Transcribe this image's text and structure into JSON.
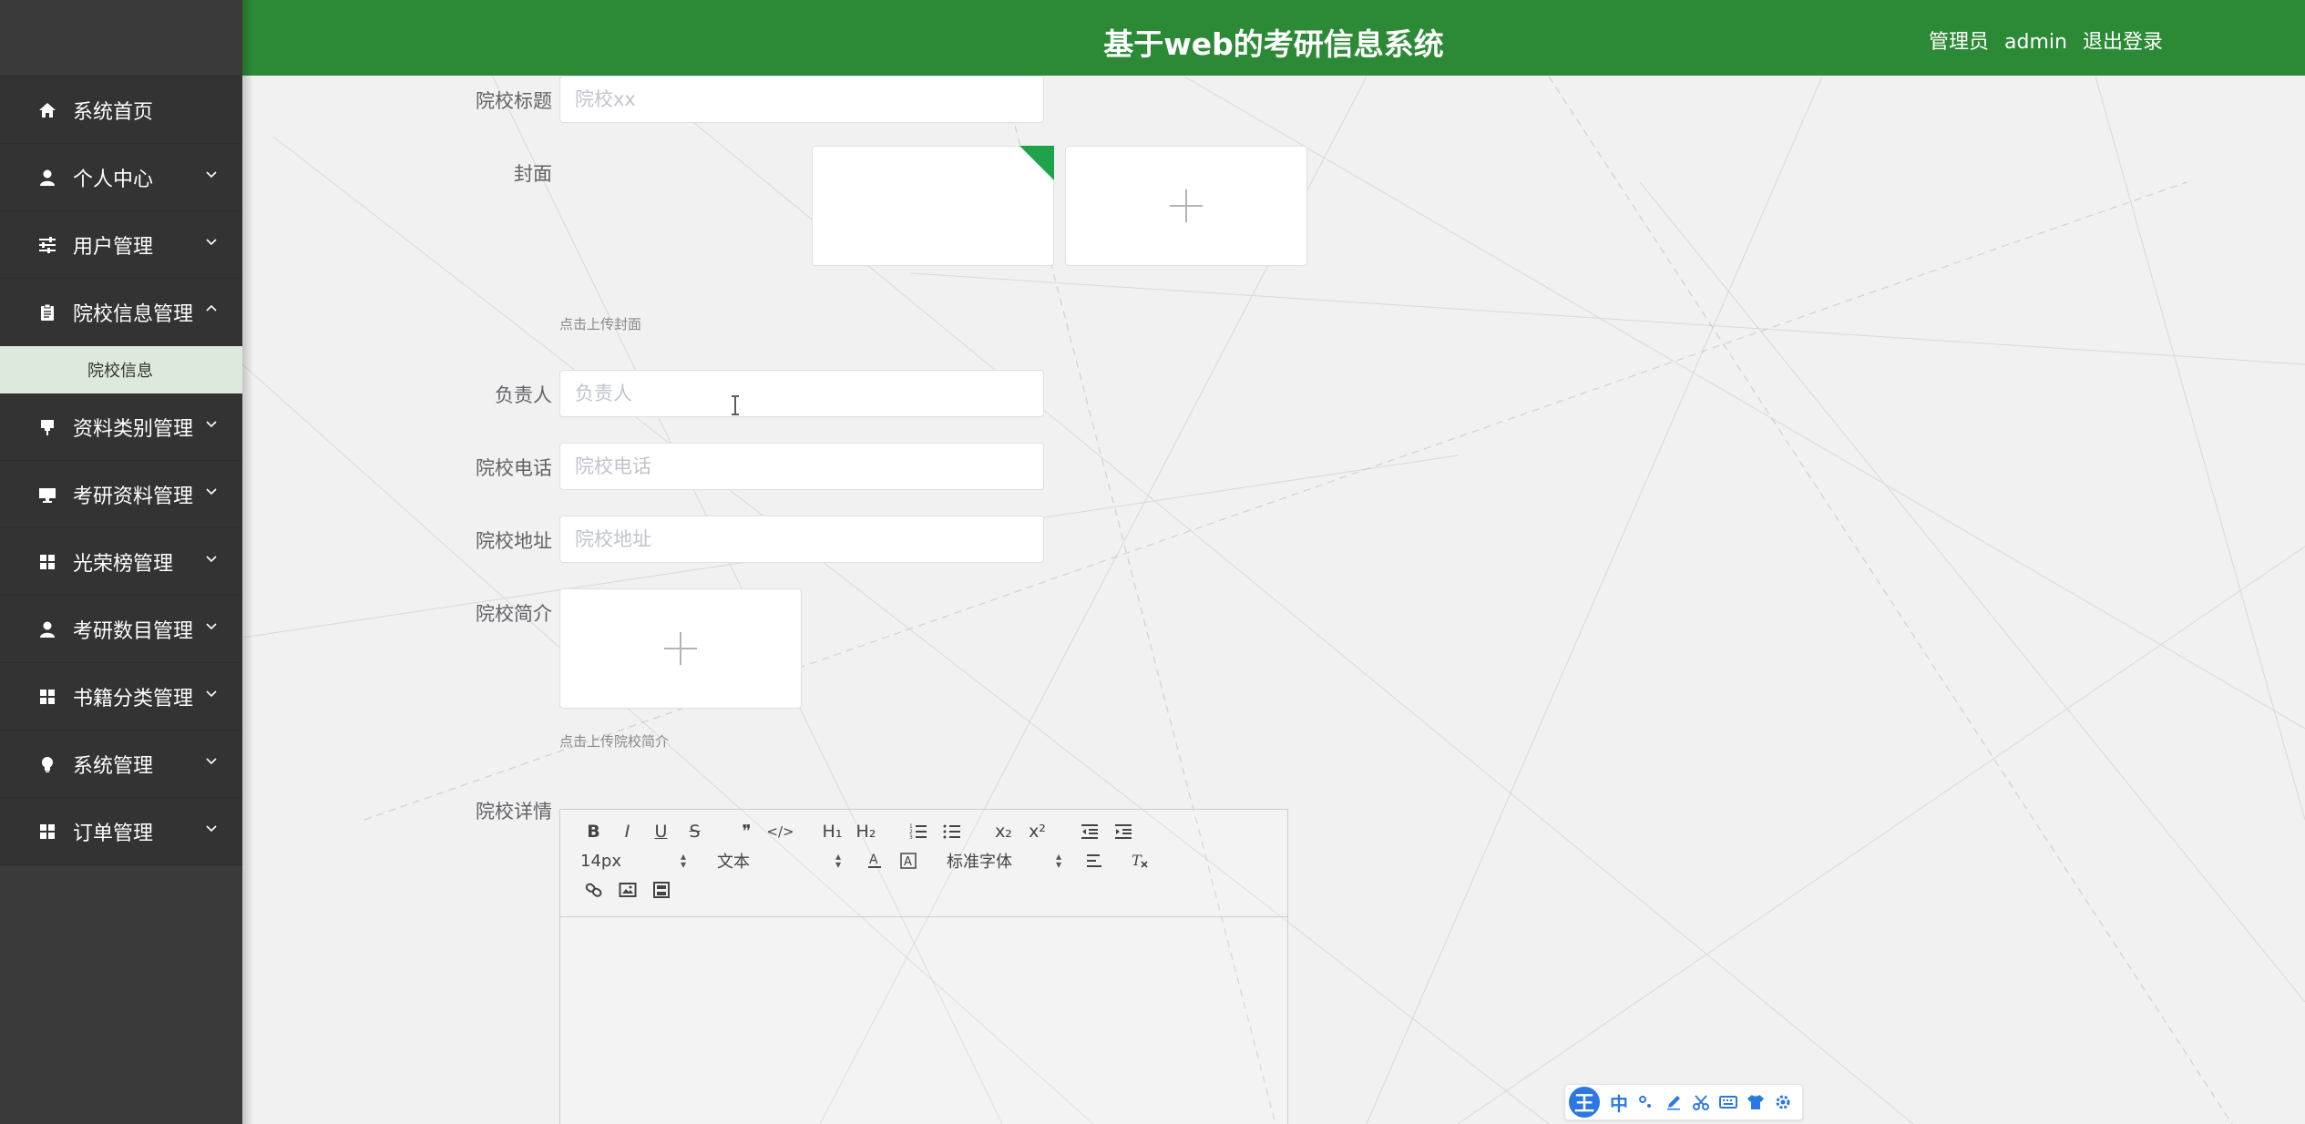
{
  "header": {
    "title": "基于web的考研信息系统",
    "user_role": "管理员",
    "username": "admin",
    "logout_label": "退出登录"
  },
  "sidebar": {
    "items": [
      {
        "label": "系统首页",
        "icon": "home-icon",
        "has_children": false
      },
      {
        "label": "个人中心",
        "icon": "user-icon",
        "has_children": true
      },
      {
        "label": "用户管理",
        "icon": "sliders-icon",
        "has_children": true
      },
      {
        "label": "院校信息管理",
        "icon": "clipboard-icon",
        "has_children": true,
        "expanded": true,
        "children": [
          {
            "label": "院校信息"
          }
        ]
      },
      {
        "label": "资料类别管理",
        "icon": "pin-icon",
        "has_children": true
      },
      {
        "label": "考研资料管理",
        "icon": "monitor-icon",
        "has_children": true
      },
      {
        "label": "光荣榜管理",
        "icon": "grid-icon",
        "has_children": true
      },
      {
        "label": "考研数目管理",
        "icon": "user-icon",
        "has_children": true
      },
      {
        "label": "书籍分类管理",
        "icon": "grid-icon",
        "has_children": true
      },
      {
        "label": "系统管理",
        "icon": "bulb-icon",
        "has_children": true
      },
      {
        "label": "订单管理",
        "icon": "grid-icon",
        "has_children": true
      }
    ]
  },
  "form": {
    "title_label": "院校标题",
    "title_placeholder": "院校xx",
    "cover_label": "封面",
    "cover_tip": "点击上传封面",
    "manager_label": "负责人",
    "manager_placeholder": "负责人",
    "phone_label": "院校电话",
    "phone_placeholder": "院校电话",
    "address_label": "院校地址",
    "address_placeholder": "院校地址",
    "intro_label": "院校简介",
    "intro_tip": "点击上传院校简介",
    "detail_label": "院校详情"
  },
  "editor": {
    "font_size": "14px",
    "header_select": "文本",
    "font_family": "标准字体",
    "buttons_row1": [
      "B",
      "I",
      "U",
      "S",
      "❞",
      "</>",
      "H₁",
      "H₂",
      "ol",
      "ul",
      "x₂",
      "x²",
      "outdent",
      "indent"
    ],
    "buttons_row2_icons": [
      "font-color-icon",
      "background-color-icon",
      "align-icon",
      "clear-format-icon"
    ],
    "buttons_row3_icons": [
      "link-icon",
      "image-icon",
      "video-icon"
    ]
  },
  "ime": {
    "logo": "王",
    "lang": "中",
    "icons": [
      "punctuation-icon",
      "pen-icon",
      "scissors-icon",
      "keyboard-icon",
      "skin-icon",
      "settings-icon"
    ]
  },
  "colors": {
    "header_bg": "#2c8a36",
    "sidebar_bg": "#333333",
    "submenu_bg": "#dde9dc",
    "accent": "#1fa34a"
  }
}
